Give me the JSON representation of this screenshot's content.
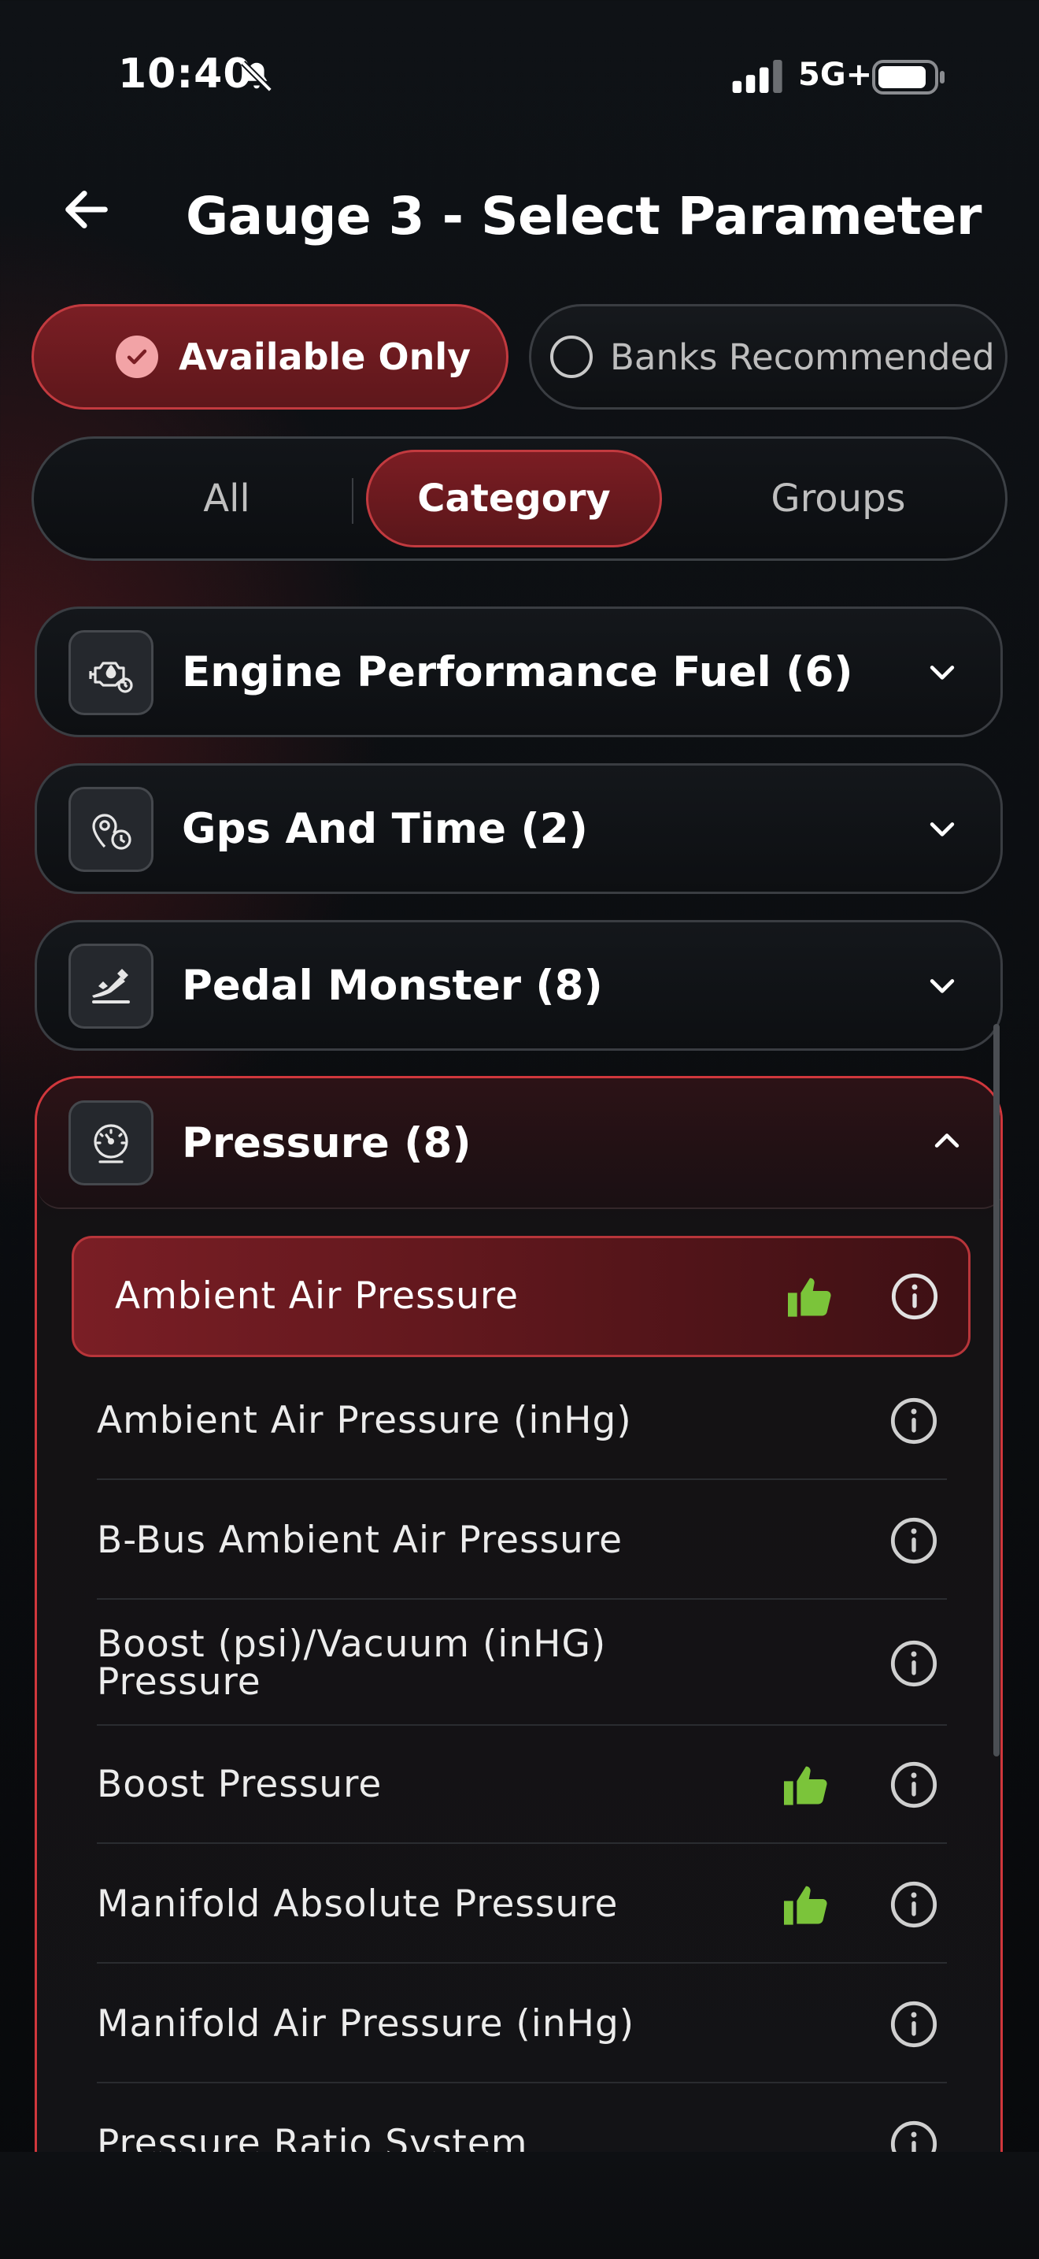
{
  "status_bar": {
    "time": "10:40",
    "network": "5G+",
    "icons": [
      "bell-slash-icon",
      "signal-icon",
      "battery-icon"
    ]
  },
  "header": {
    "back_icon": "arrow-left-icon",
    "title": "Gauge 3 - Select Parameter"
  },
  "filters": {
    "available_only": {
      "label": "Available Only",
      "checked": true
    },
    "banks_recommended": {
      "label": "Banks Recommended",
      "checked": false
    }
  },
  "view_tabs": [
    {
      "label": "All",
      "active": false
    },
    {
      "label": "Category",
      "active": true
    },
    {
      "label": "Groups",
      "active": false
    }
  ],
  "categories": [
    {
      "label": "Engine Performance Fuel (6)",
      "icon": "engine-fuel-icon",
      "expanded": false
    },
    {
      "label": "Gps And Time (2)",
      "icon": "location-clock-icon",
      "expanded": false
    },
    {
      "label": "Pedal Monster (8)",
      "icon": "pedal-icon",
      "expanded": false
    },
    {
      "label": "Pressure (8)",
      "icon": "gauge-icon",
      "expanded": true
    }
  ],
  "pressure_parameters": [
    {
      "label": "Ambient Air Pressure",
      "recommended": true,
      "selected": true
    },
    {
      "label": "Ambient Air Pressure (inHg)",
      "recommended": false,
      "selected": false
    },
    {
      "label": "B-Bus Ambient Air Pressure",
      "recommended": false,
      "selected": false
    },
    {
      "label": "Boost (psi)/Vacuum (inHG) Pressure",
      "recommended": false,
      "selected": false
    },
    {
      "label": "Boost Pressure",
      "recommended": true,
      "selected": false
    },
    {
      "label": "Manifold Absolute Pressure",
      "recommended": true,
      "selected": false
    },
    {
      "label": "Manifold Air Pressure (inHg)",
      "recommended": false,
      "selected": false
    },
    {
      "label": "Pressure Ratio System",
      "recommended": false,
      "selected": false
    }
  ],
  "colors": {
    "accent_red": "#7a1e24",
    "accent_border": "#c23a3f",
    "recommended_green": "#7bc43a",
    "background": "#0b0d10"
  }
}
